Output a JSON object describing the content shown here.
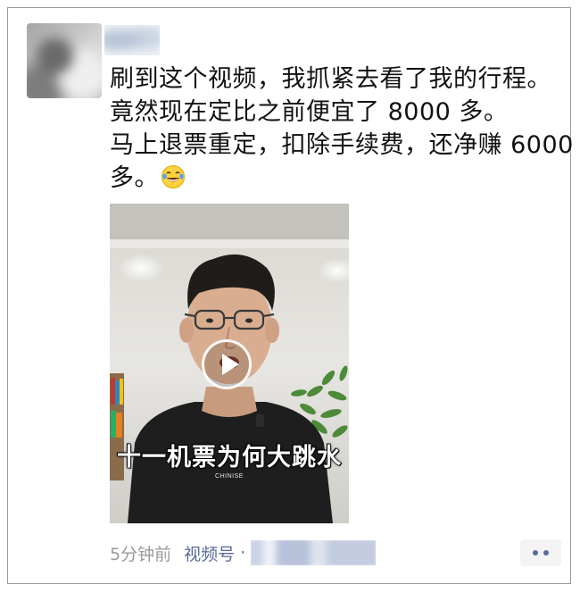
{
  "post": {
    "lines": [
      "刷到这个视频，我抓紧去看了我的行程。",
      "竟然现在定比之前便宜了 8000 多。",
      "马上退票重定，扣除手续费，还净赚 6000",
      "多。"
    ],
    "emoji": "laughing-with-tears-emoji"
  },
  "video": {
    "caption": "十一机票为何大跳水",
    "shirt_text": "CHINISE"
  },
  "footer": {
    "timestamp": "5分钟前",
    "channel_label": "视频号",
    "separator": "·"
  },
  "colors": {
    "link": "#576b95",
    "meta": "#9b9b9b",
    "text": "#111111"
  }
}
